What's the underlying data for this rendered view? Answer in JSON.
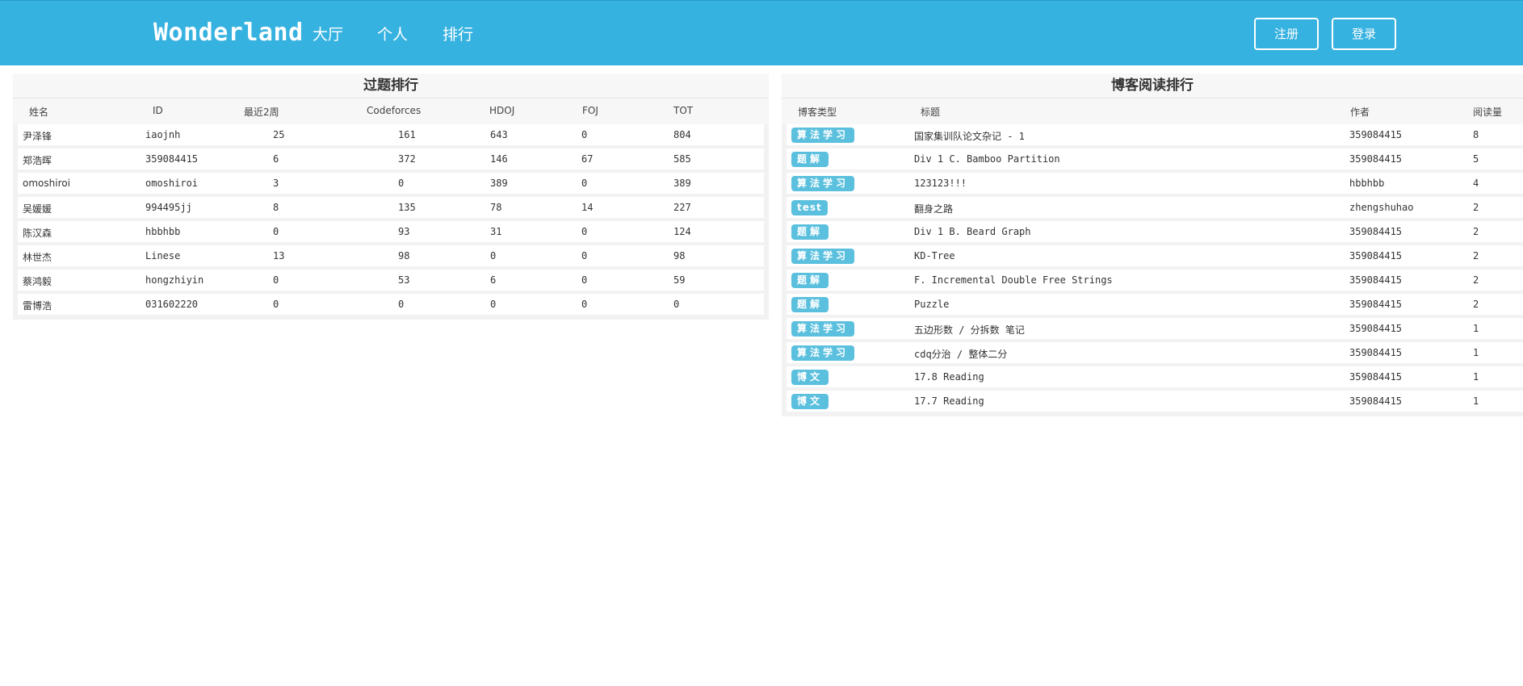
{
  "navbar": {
    "brand": "Wonderland",
    "links": [
      "大厅",
      "个人",
      "排行"
    ],
    "register_label": "注册",
    "login_label": "登录"
  },
  "solve_rank": {
    "title": "过题排行",
    "headers": [
      "姓名",
      "ID",
      "最近2周",
      "Codeforces",
      "HDOJ",
      "FOJ",
      "TOT"
    ],
    "rows": [
      [
        "尹泽锋",
        "iaojnh",
        "25",
        "161",
        "643",
        "0",
        "804"
      ],
      [
        "郑浩晖",
        "359084415",
        "6",
        "372",
        "146",
        "67",
        "585"
      ],
      [
        "omoshiroi",
        "omoshiroi",
        "3",
        "0",
        "389",
        "0",
        "389"
      ],
      [
        "吴媛媛",
        "994495jj",
        "8",
        "135",
        "78",
        "14",
        "227"
      ],
      [
        "陈汉森",
        "hbbhbb",
        "0",
        "93",
        "31",
        "0",
        "124"
      ],
      [
        "林世杰",
        "Linese",
        "13",
        "98",
        "0",
        "0",
        "98"
      ],
      [
        "蔡鸿毅",
        "hongzhiyin",
        "0",
        "53",
        "6",
        "0",
        "59"
      ],
      [
        "雷博浩",
        "031602220",
        "0",
        "0",
        "0",
        "0",
        "0"
      ]
    ]
  },
  "blog_rank": {
    "title": "博客阅读排行",
    "headers": [
      "博客类型",
      "标题",
      "作者",
      "阅读量"
    ],
    "rows": [
      [
        "算法学习",
        "国家集训队论文杂记 - 1",
        "359084415",
        "8"
      ],
      [
        "题解",
        "Div 1 C. Bamboo Partition",
        "359084415",
        "5"
      ],
      [
        "算法学习",
        "123123!!!",
        "hbbhbb",
        "4"
      ],
      [
        "test",
        "翻身之路",
        "zhengshuhao",
        "2"
      ],
      [
        "题解",
        "Div 1 B. Beard Graph",
        "359084415",
        "2"
      ],
      [
        "算法学习",
        "KD-Tree",
        "359084415",
        "2"
      ],
      [
        "题解",
        "F. Incremental Double Free Strings",
        "359084415",
        "2"
      ],
      [
        "题解",
        "Puzzle",
        "359084415",
        "2"
      ],
      [
        "算法学习",
        "五边形数 / 分拆数 笔记",
        "359084415",
        "1"
      ],
      [
        "算法学习",
        "cdq分治 / 整体二分",
        "359084415",
        "1"
      ],
      [
        "博文",
        "17.8 Reading",
        "359084415",
        "1"
      ],
      [
        "博文",
        "17.7 Reading",
        "359084415",
        "1"
      ]
    ]
  },
  "colors": {
    "navbar": "#36b2e0",
    "tag": "#5bc0de",
    "panel_bg": "#f2f2f2"
  }
}
